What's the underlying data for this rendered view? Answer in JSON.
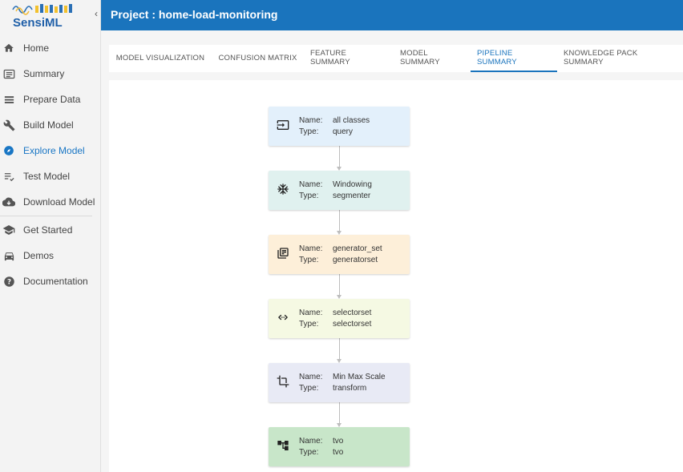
{
  "sidebar": {
    "logo_text": "SensiML",
    "items": [
      {
        "label": "Home",
        "icon": "home-icon"
      },
      {
        "label": "Summary",
        "icon": "summary-icon"
      },
      {
        "label": "Prepare Data",
        "icon": "list-icon"
      },
      {
        "label": "Build Model",
        "icon": "wrench-icon"
      },
      {
        "label": "Explore Model",
        "icon": "compass-icon",
        "active": true
      },
      {
        "label": "Test Model",
        "icon": "test-icon"
      },
      {
        "label": "Download Model",
        "icon": "cloud-download-icon"
      },
      {
        "label": "Get Started",
        "icon": "school-icon"
      },
      {
        "label": "Demos",
        "icon": "car-icon"
      },
      {
        "label": "Documentation",
        "icon": "help-icon"
      }
    ]
  },
  "header": {
    "title": "Project : home-load-monitoring"
  },
  "tabs": [
    {
      "label": "MODEL VISUALIZATION"
    },
    {
      "label": "CONFUSION MATRIX"
    },
    {
      "label": "FEATURE SUMMARY"
    },
    {
      "label": "MODEL SUMMARY"
    },
    {
      "label": "PIPELINE SUMMARY",
      "active": true
    },
    {
      "label": "KNOWLEDGE PACK SUMMARY"
    }
  ],
  "pipeline": {
    "name_label": "Name:",
    "type_label": "Type:",
    "steps": [
      {
        "name": "all classes",
        "type": "query",
        "color": "#e3f0fb",
        "icon": "input-icon"
      },
      {
        "name": "Windowing",
        "type": "segmenter",
        "color": "#e0f1ef",
        "icon": "snowflake-icon"
      },
      {
        "name": "generator_set",
        "type": "generatorset",
        "color": "#fdefd9",
        "icon": "library-icon"
      },
      {
        "name": "selectorset",
        "type": "selectorset",
        "color": "#f5f9e3",
        "icon": "code-icon"
      },
      {
        "name": "Min Max Scale",
        "type": "transform",
        "color": "#e8eaf5",
        "icon": "crop-icon"
      },
      {
        "name": "tvo",
        "type": "tvo",
        "color": "#c8e6c9",
        "icon": "tree-icon"
      }
    ]
  }
}
